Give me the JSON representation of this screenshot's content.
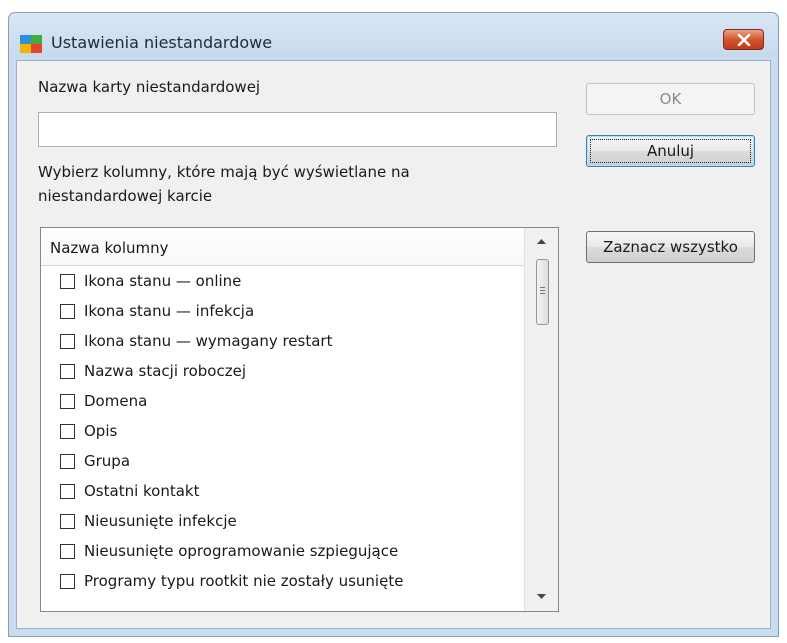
{
  "window": {
    "title": "Ustawienia niestandardowe",
    "close_icon": "close-icon"
  },
  "form": {
    "name_label": "Nazwa karty niestandardowej",
    "name_value": "",
    "columns_prompt_line1": "Wybierz kolumny, które mają być wyświetlane na",
    "columns_prompt_line2": "niestandardowej karcie"
  },
  "buttons": {
    "ok": "OK",
    "ok_enabled": false,
    "cancel": "Anuluj",
    "select_all": "Zaznacz wszystko"
  },
  "columns_list": {
    "header": "Nazwa kolumny",
    "items": [
      {
        "label": "Ikona stanu — online",
        "checked": false
      },
      {
        "label": "Ikona stanu — infekcja",
        "checked": false
      },
      {
        "label": "Ikona stanu — wymagany restart",
        "checked": false
      },
      {
        "label": "Nazwa stacji roboczej",
        "checked": false
      },
      {
        "label": "Domena",
        "checked": false
      },
      {
        "label": "Opis",
        "checked": false
      },
      {
        "label": "Grupa",
        "checked": false
      },
      {
        "label": "Ostatni kontakt",
        "checked": false
      },
      {
        "label": "Nieusunięte infekcje",
        "checked": false
      },
      {
        "label": "Nieusunięte oprogramowanie szpiegujące",
        "checked": false
      },
      {
        "label": "Programy typu rootkit nie zostały usunięte",
        "checked": false
      }
    ]
  },
  "colors": {
    "frame": "#c9dcef",
    "client_bg": "#f0f0f0",
    "close_button": "#c0391b",
    "default_button_border": "#3c7fb1"
  }
}
